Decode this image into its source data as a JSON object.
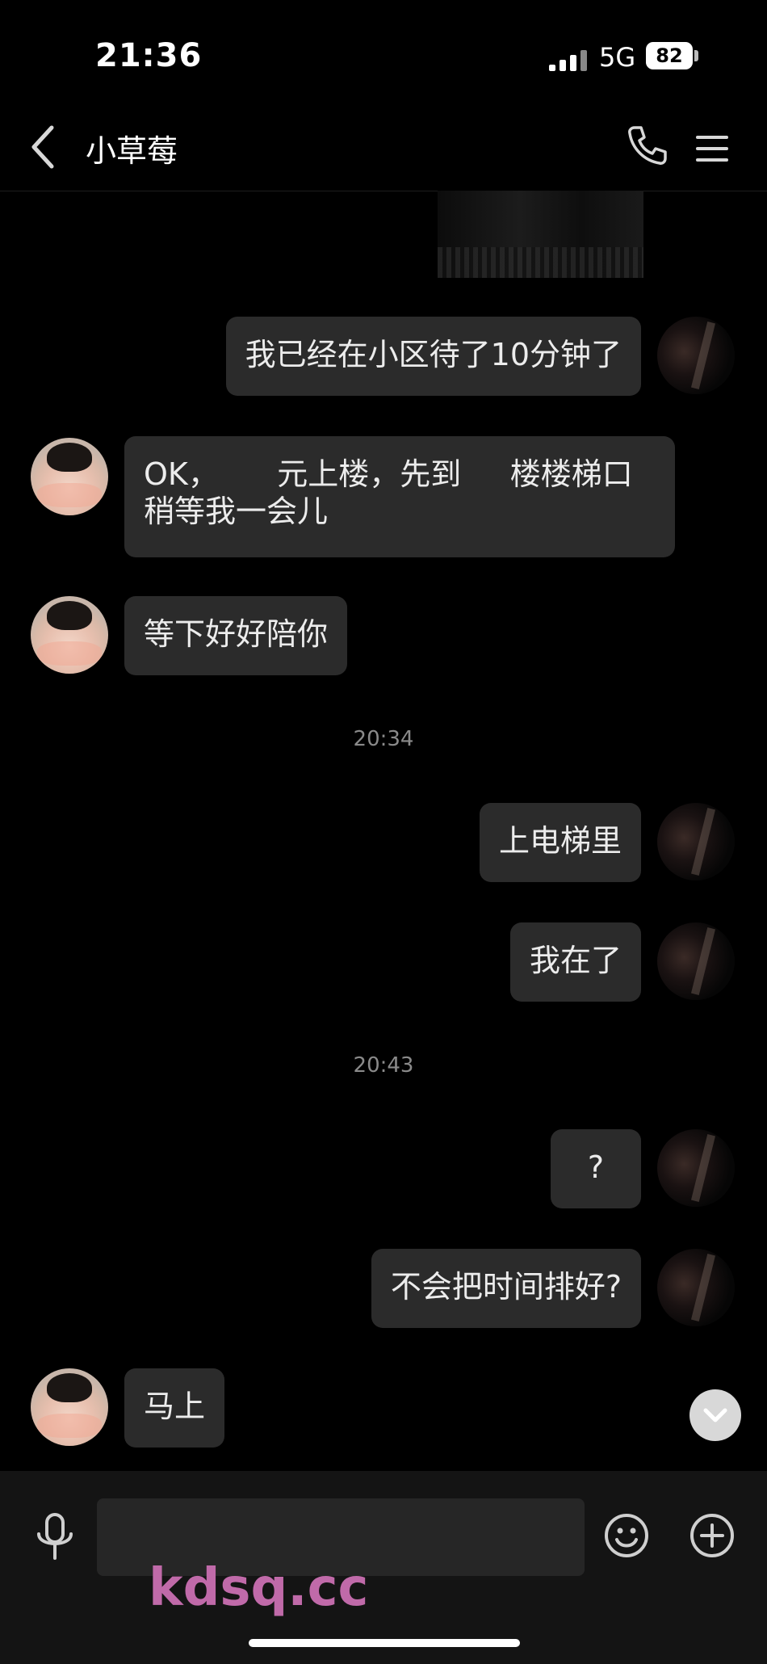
{
  "status": {
    "time": "21:36",
    "network": "5G",
    "battery": "82"
  },
  "header": {
    "title": "小草莓"
  },
  "chat": {
    "messages": [
      {
        "side": "me",
        "text": "我已经在小区待了10分钟了"
      },
      {
        "side": "her",
        "text": "OK，      元上楼，先到     楼楼梯口\n稍等我一会儿"
      },
      {
        "side": "her",
        "text": "等下好好陪你"
      },
      {
        "side": "time",
        "text": "20:34"
      },
      {
        "side": "me",
        "text": "上电梯里"
      },
      {
        "side": "me",
        "text": "我在了"
      },
      {
        "side": "time",
        "text": "20:43"
      },
      {
        "side": "me",
        "text": "?"
      },
      {
        "side": "me",
        "text": "不会把时间排好?"
      },
      {
        "side": "her",
        "text": "马上"
      }
    ]
  },
  "input": {
    "value": "",
    "placeholder": ""
  },
  "watermark": {
    "text": "kdsq.cc",
    "color": "#c06aa9"
  },
  "icons": [
    "back-icon",
    "phone-icon",
    "menu-icon",
    "mic-icon",
    "emoji-icon",
    "plus-icon",
    "chevron-down-icon"
  ]
}
